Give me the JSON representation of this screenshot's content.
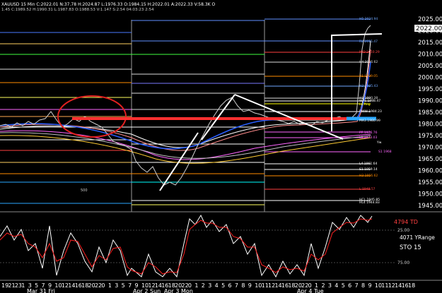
{
  "header": {
    "line1": "XAUUSD 15 Min  C:2022.01  N:37.78  H:2024.87  L:1976.33  O:1984.15  H:2022.01  A:2022.33  V:58.3K  O",
    "line2": "1.45  C:1989.52  H:1990.31  L:1987.83  O:1988.53  V:1.147  S:2.54  04:03:23  2:54"
  },
  "price_axis": {
    "ticks": [
      "2025.00",
      "2020.00",
      "2015.00",
      "2010.00",
      "2005.00",
      "2000.00",
      "1995.00",
      "1990.00",
      "1985.00",
      "1980.00",
      "1975.00",
      "1970.00",
      "1965.00",
      "1960.00",
      "1955.00",
      "1950.00",
      "1945.00"
    ],
    "last_price": "2022.00"
  },
  "level_labels": [
    {
      "text": "H5 2024.94",
      "color": "#6fa8ff"
    },
    {
      "text": "R2 2015.47",
      "color": "#6fa8ff"
    },
    {
      "text": "MID 2010.29",
      "color": "#ff4040"
    },
    {
      "text": "H4 2006.62",
      "color": "#dddddd"
    },
    {
      "text": "R1 1999.05",
      "color": "#ff8c00"
    },
    {
      "text": "H3 1995.43",
      "color": "#6fa8ff"
    },
    {
      "text": "H1 1990.38",
      "color": "#dddddd"
    },
    {
      "text": "WP1 1988.47",
      "color": "#ffffff"
    },
    {
      "text": "L4 Rng",
      "color": "#ffff00"
    },
    {
      "text": "RWW 1984.23",
      "color": "#ffffff"
    },
    {
      "text": "MA3 1980.99",
      "color": "#ffffff"
    },
    {
      "text": "PP 1976.76",
      "color": "#ff66ff"
    },
    {
      "text": "L3 1973.03",
      "color": "#ff66ff"
    },
    {
      "text": "Yw",
      "color": "#ffffff"
    },
    {
      "text": "S1 1968",
      "color": "#ff66ff"
    },
    {
      "text": "L4 1961.64",
      "color": "#ffffff"
    },
    {
      "text": "S1 1959.14",
      "color": "#ffffff"
    },
    {
      "text": "H3 1956.62",
      "color": "#ff8c00"
    },
    {
      "text": "L 1949.57",
      "color": "#ff4040"
    },
    {
      "text": "HCL 1945.85",
      "color": "#ffffff"
    },
    {
      "text": "HL4 1944.83",
      "color": "#ffffff"
    }
  ],
  "small_label": "500",
  "oscillator": {
    "td_label": "4794 TD",
    "yrange_label": "4071 YRange",
    "sto_label": "STO  15",
    "upper_level": "25.00",
    "lower_level": "75.00"
  },
  "time_axis": {
    "hours": [
      "19",
      "21",
      "23",
      "1",
      "3",
      "5",
      "7",
      "9",
      "10",
      "12",
      "14",
      "16",
      "18",
      "20",
      "22",
      "0",
      "1",
      "3",
      "5",
      "7",
      "9",
      "10",
      "12",
      "14",
      "16",
      "18",
      "20",
      "22",
      "0",
      "1",
      "2",
      "3",
      "4",
      "5",
      "6",
      "7",
      "8",
      "9",
      "10",
      "11",
      "12",
      "14",
      "16",
      "18",
      "20",
      "22",
      "0",
      "1",
      "2",
      "3",
      "4",
      "5",
      "6",
      "7",
      "8",
      "9",
      "10",
      "11",
      "12",
      "14",
      "16",
      "18"
    ],
    "dates": [
      "Mar 31 Fri",
      "Apr 2 Sun",
      "Apr 3 Mon",
      "Apr 4 Tue"
    ]
  },
  "colors": {
    "background": "#000000",
    "grid": "#444444",
    "oscillator_fast": "#ffffff",
    "oscillator_slow": "#ff2020",
    "circle_annotation": "#e02020",
    "resistance_line": "#ff3030",
    "support_highlight": "#2aa8ff"
  }
}
